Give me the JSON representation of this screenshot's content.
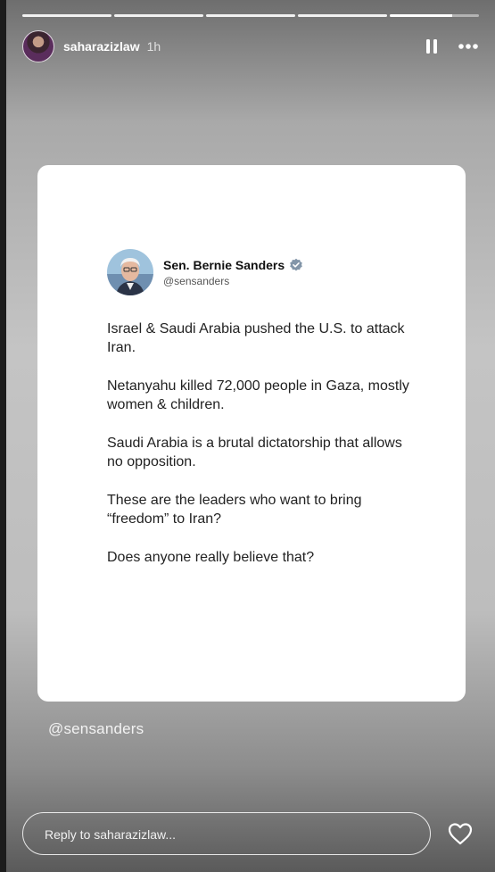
{
  "story": {
    "progress": {
      "segments": 5,
      "current_index": 4,
      "current_fraction": 0.7
    },
    "user": {
      "username": "saharazizlaw",
      "time": "1h"
    },
    "actions": {
      "pause_icon": "pause-icon",
      "more_icon": "more-horizontal-icon"
    },
    "tweet": {
      "display_name": "Sen. Bernie Sanders",
      "handle": "@sensanders",
      "verified_icon": "verified-badge-icon",
      "paragraphs": [
        "Israel & Saudi Arabia pushed the U.S. to attack Iran.",
        "Netanyahu killed 72,000 people in Gaza, mostly women & children.",
        "Saudi Arabia is a brutal dictatorship that allows no opposition.",
        "These are the leaders who want to bring “freedom” to Iran?",
        "Does anyone really believe that?"
      ]
    },
    "mention_sticker": "@sensanders",
    "reply": {
      "placeholder": "Reply to saharazizlaw..."
    },
    "like_icon": "heart-outline-icon"
  }
}
